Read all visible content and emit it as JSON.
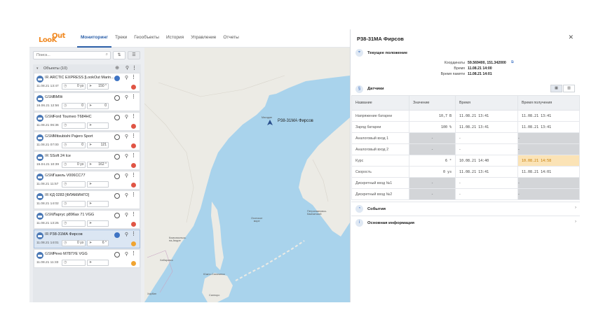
{
  "logo": {
    "part1": "LooK",
    "part2": "Out"
  },
  "nav": {
    "tabs": [
      "Мониторинг",
      "Треки",
      "Геообъекты",
      "История",
      "Управление",
      "Отчеты"
    ]
  },
  "sidebar": {
    "search_placeholder": "Поиск...",
    "group_label": "Объекты (10)",
    "items": [
      {
        "type": "IR",
        "name": "ARCTIC EXPRESS [LookOut Marin...",
        "time": "11.08.21 13:47",
        "v1": "0 уз",
        "v2": "150 °",
        "target": "blue",
        "status": "red"
      },
      {
        "type": "GSM",
        "name": "BMW",
        "time": "16.06.21 12:56",
        "v1": "0",
        "v2": "0",
        "target": "plain",
        "status": "none"
      },
      {
        "type": "GSM",
        "name": "Ford Tourneo Т684НС",
        "time": "11.08.21 06:36",
        "v1": "",
        "v2": "",
        "target": "plain",
        "status": "red"
      },
      {
        "type": "GSM",
        "name": "Mitsubishi Pajero Sport",
        "time": "11.08.21 07:00",
        "v1": "0",
        "v2": "121",
        "target": "plain",
        "status": "red"
      },
      {
        "type": "IR",
        "name": "SSoft 24 Ice",
        "time": "15.04.21 10:39",
        "v1": "0 уз",
        "v2": "162 °",
        "target": "plain",
        "status": "red"
      },
      {
        "type": "GSM",
        "name": "Газель V006СС77",
        "time": "11.08.21 11:57",
        "v1": "",
        "v2": "",
        "target": "plain",
        "status": "red"
      },
      {
        "type": "IR",
        "name": "КД 0283 [ФЛАМИНГО]",
        "time": "11.08.21 14:02",
        "v1": "",
        "v2": "",
        "target": "plain",
        "status": "none"
      },
      {
        "type": "GSM",
        "name": "Ларгус р896ах 71 VGG",
        "time": "11.08.21 13:25",
        "v1": "",
        "v2": "",
        "target": "plain",
        "status": "red"
      },
      {
        "type": "IR",
        "name": "Р38-31МА Фирсов",
        "time": "11.08.21 14:01",
        "v1": "0 уз",
        "v2": "6 °",
        "target": "blue",
        "status": "orange",
        "selected": true
      },
      {
        "type": "GSM",
        "name": "Рено М787УЕ VGG",
        "time": "11.08.21 11:33",
        "v1": "",
        "v2": "",
        "target": "plain",
        "status": "orange"
      }
    ]
  },
  "map": {
    "marker_label": "Р38-31МА Фирсов",
    "labels": {
      "magadan": "Магадан",
      "sea": "Охотское\nморе",
      "petro": "Петропавловск-\nКамчатский",
      "komsomolsk": "Комсомольск-\nна-Амуре",
      "yuzhno": "Южно-Сахалинск",
      "khabarovsk": "Хабаровск",
      "harbin": "Харбин",
      "sapporo": "Саппоро"
    }
  },
  "panel": {
    "title": "Р38-31МА Фирсов",
    "position_title": "Текущее положение",
    "coords_label": "Координаты",
    "coords_value": "59.569400, 151.342000",
    "time_label": "Время",
    "time_value": "11.08.21 14:00",
    "mem_label": "Время памяти",
    "mem_value": "11.08.21 14:01",
    "sensors_title": "Датчики",
    "columns": [
      "Название",
      "Значение",
      "Время",
      "Время получения"
    ],
    "rows": [
      {
        "name": "Напряжение батареи",
        "value": "10,7 В",
        "time": "11.08.21 13:41",
        "recv": "11.08.21 13:41"
      },
      {
        "name": "Заряд батареи",
        "value": "100 %",
        "time": "11.08.21 13:41",
        "recv": "11.08.21 13:41"
      },
      {
        "name": "Аналоговый вход 1",
        "value": "-",
        "time": "-",
        "recv": "-"
      },
      {
        "name": "Аналоговый вход 2",
        "value": "-",
        "time": "-",
        "recv": "-"
      },
      {
        "name": "Курс",
        "value": "6 °",
        "time": "10.08.21 14:40",
        "recv": "10.08.21 14:58"
      },
      {
        "name": "Скорость",
        "value": "0 уз",
        "time": "11.08.21 13:41",
        "recv": "11.08.21 14:01"
      },
      {
        "name": "Дискретный вход №1",
        "value": "-",
        "time": "-",
        "recv": "-"
      },
      {
        "name": "Дискретный вход №2",
        "value": "-",
        "time": "-",
        "recv": "-"
      }
    ],
    "events_title": "События",
    "info_title": "Основная информация"
  }
}
